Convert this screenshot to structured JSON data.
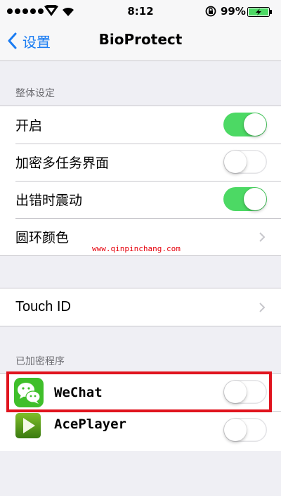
{
  "status_bar": {
    "time": "8:12",
    "battery_percent": "99%",
    "icons": [
      "signal-dots-icon",
      "carrier-logo-icon",
      "wifi-icon",
      "rotation-lock-icon",
      "battery-charging-icon"
    ],
    "battery_color": "#4cd964"
  },
  "nav": {
    "back_label": "设置",
    "title": "BioProtect"
  },
  "section_general": {
    "header": "整体设定",
    "rows": [
      {
        "label": "开启",
        "type": "toggle",
        "on": true
      },
      {
        "label": "加密多任务界面",
        "type": "toggle",
        "on": false
      },
      {
        "label": "出错时震动",
        "type": "toggle",
        "on": true
      },
      {
        "label": "圆环颜色",
        "type": "disclosure"
      }
    ]
  },
  "section_touch": {
    "rows": [
      {
        "label": "Touch ID",
        "type": "disclosure"
      }
    ]
  },
  "section_apps": {
    "header": "已加密程序",
    "rows": [
      {
        "label": "WeChat",
        "icon": "wechat-icon",
        "on": false,
        "highlighted": true
      },
      {
        "label": "AcePlayer",
        "icon": "aceplayer-icon",
        "on": false
      }
    ]
  },
  "watermark": "www.qinpinchang.com",
  "colors": {
    "accent": "#1a7cf2",
    "toggle_on": "#4cd964",
    "highlight": "#e0141e",
    "background": "#efeff4"
  }
}
